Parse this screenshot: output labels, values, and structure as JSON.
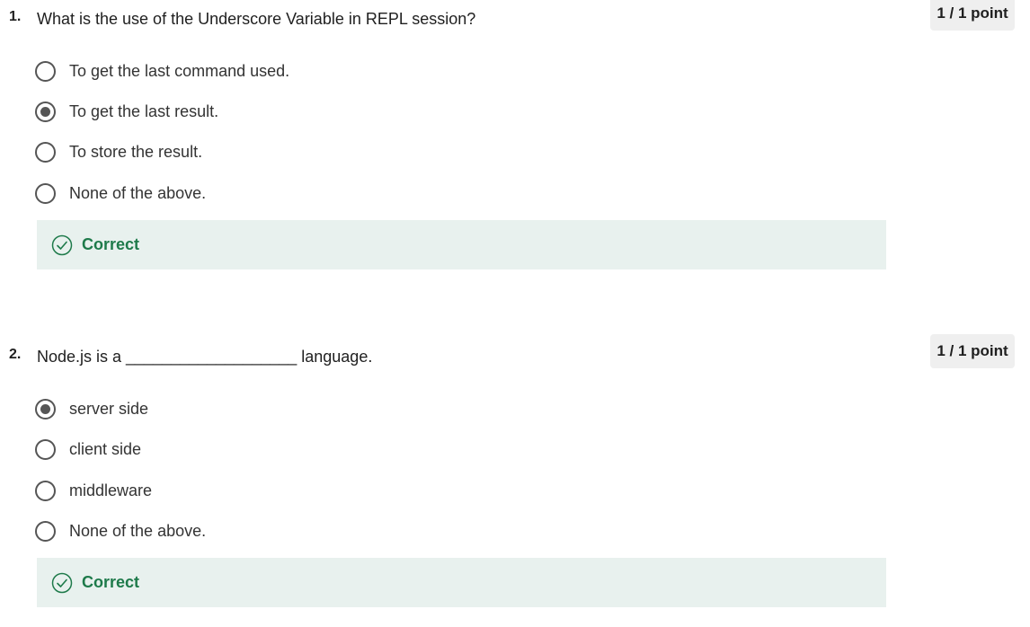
{
  "questions": [
    {
      "number": "1.",
      "text": "What is the use of the Underscore Variable in REPL session?",
      "points": "1 / 1 point",
      "options": [
        {
          "label": "To get the last command used.",
          "selected": false
        },
        {
          "label": "To get the last result.",
          "selected": true
        },
        {
          "label": "To store the result.",
          "selected": false
        },
        {
          "label": "None of the above.",
          "selected": false
        }
      ],
      "feedback": "Correct"
    },
    {
      "number": "2.",
      "text": "Node.js is a ___________________ language.",
      "points": "1 / 1 point",
      "options": [
        {
          "label": "server side",
          "selected": true
        },
        {
          "label": "client side",
          "selected": false
        },
        {
          "label": "middleware",
          "selected": false
        },
        {
          "label": "None of the above.",
          "selected": false
        }
      ],
      "feedback": "Correct"
    }
  ],
  "colors": {
    "feedback_bg": "#e8f1ee",
    "feedback_text": "#1e7a4a",
    "badge_bg": "#efefef",
    "radio": "#555555"
  }
}
